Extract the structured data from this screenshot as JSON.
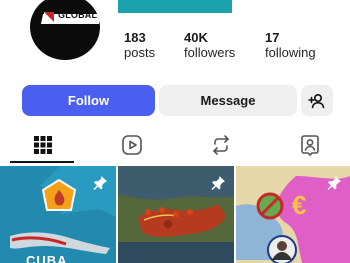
{
  "profile": {
    "avatar_text": "GLOBAL",
    "stats": [
      {
        "value": "183",
        "label": "posts"
      },
      {
        "value": "40K",
        "label": "followers"
      },
      {
        "value": "17",
        "label": "following"
      }
    ]
  },
  "actions": {
    "follow_label": "Follow",
    "message_label": "Message"
  },
  "tabs": [
    {
      "icon": "grid-icon",
      "selected": true
    },
    {
      "icon": "reels-icon",
      "selected": false
    },
    {
      "icon": "reposts-icon",
      "selected": false
    },
    {
      "icon": "tagged-icon",
      "selected": false
    }
  ],
  "posts": [
    {
      "caption": "CUBA",
      "pinned": true
    },
    {
      "pinned": true
    },
    {
      "pinned": true
    }
  ],
  "colors": {
    "follow_blue": "#4a5ff0",
    "header_teal": "#1aa2ad",
    "button_grey": "#efefef"
  }
}
